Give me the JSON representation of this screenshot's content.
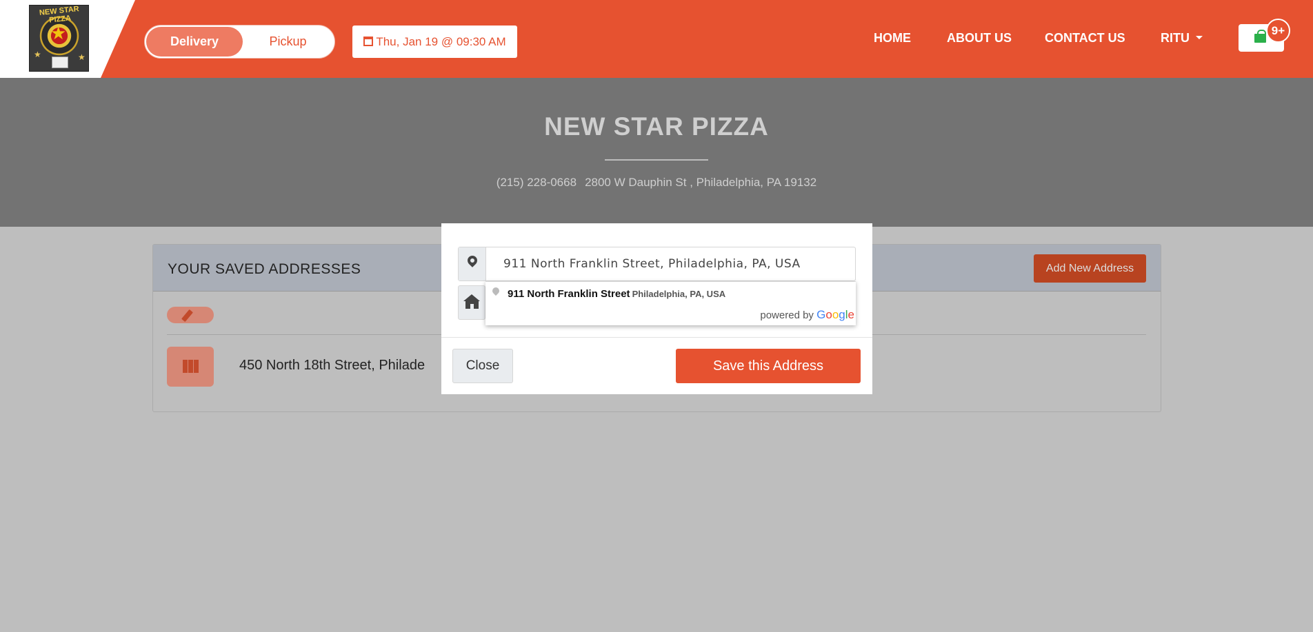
{
  "header": {
    "order_modes": [
      "Delivery",
      "Pickup"
    ],
    "selected_mode": "Delivery",
    "schedule": "Thu, Jan 19 @ 09:30 AM",
    "nav": [
      "HOME",
      "ABOUT US",
      "CONTACT US",
      "RITU"
    ],
    "cart_badge": "9+"
  },
  "hero": {
    "title": "NEW STAR PIZZA",
    "phone": "(215) 228-0668",
    "address": "2800 W Dauphin St , Philadelphia, PA 19132"
  },
  "addresses_card": {
    "title": "YOUR SAVED ADDRESSES",
    "add_button": "Add New Address",
    "saved_address": "450 North 18th Street, Philade"
  },
  "modal": {
    "address_value": "911 North Franklin Street, Philadelphia, PA, USA",
    "suggestion_main": "911 North Franklin Street",
    "suggestion_secondary": "Philadelphia, PA, USA",
    "powered_by": "powered by",
    "google": "Google",
    "close_button": "Close",
    "save_button": "Save this Address"
  },
  "colors": {
    "brand": "#e65230",
    "hero_overlay": "#737373",
    "page_overlay": "#bebebe",
    "cart_icon": "#2bb04a"
  },
  "icons": [
    "calendar-icon",
    "map-marker-icon",
    "home-icon",
    "pencil-icon",
    "map-icon",
    "shopping-bag-icon",
    "caret-down-icon"
  ]
}
